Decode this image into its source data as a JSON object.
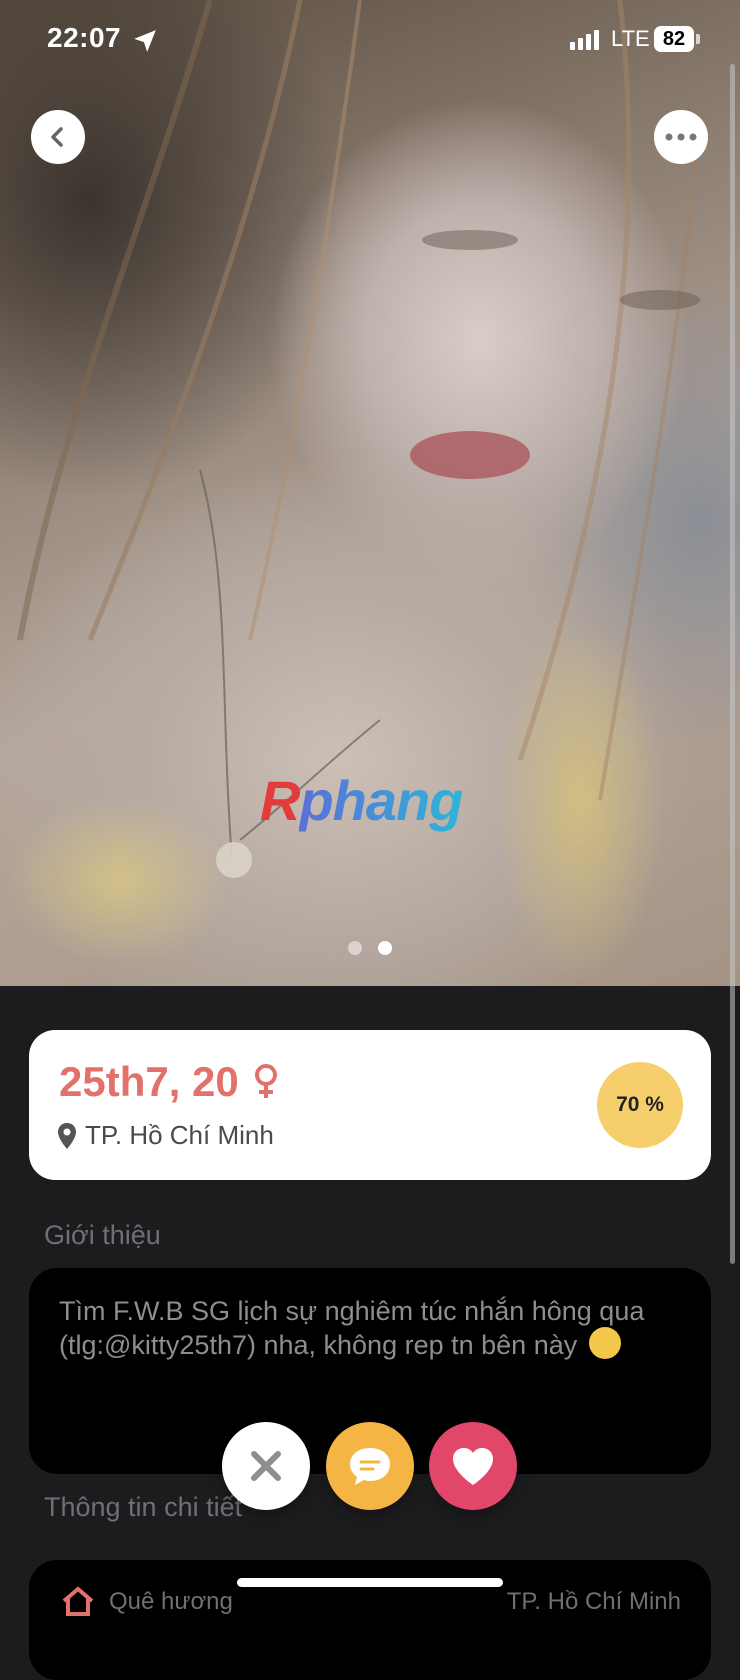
{
  "status_bar": {
    "time": "22:07",
    "network": "LTE",
    "battery": "82"
  },
  "photo": {
    "watermark_r": "R",
    "watermark_rest": "phang",
    "page_count": 2,
    "current_page": 2
  },
  "profile": {
    "name_age": "25th7, 20",
    "location": "TP. Hồ Chí Minh",
    "match_percent": "70 %"
  },
  "intro": {
    "title": "Giới thiệu",
    "text": "Tìm F.W.B SG lịch sự nghiêm túc nhắn hông qua (tlg:@kitty25th7) nha, không rep tn bên này"
  },
  "details": {
    "title": "Thông tin chi tiết",
    "row_label": "Quê hương",
    "row_value": "TP. Hồ Chí Minh"
  },
  "colors": {
    "accent": "#e2706b",
    "match_badge": "#f6cf6c",
    "like": "#e2476a",
    "message": "#f5b544"
  }
}
